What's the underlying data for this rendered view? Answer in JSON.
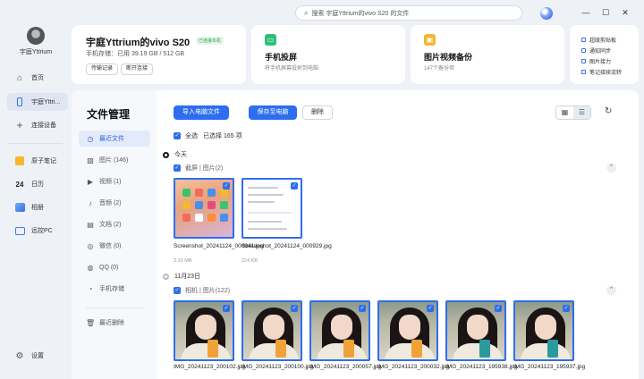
{
  "window": {
    "search_placeholder": "搜索 宇庭Yttrium的vivo S20 的文件",
    "controls": [
      "—",
      "☐",
      "✕"
    ]
  },
  "rail": {
    "device_name": "宇庭Yttrium",
    "items": [
      {
        "label": "首页",
        "icon": "home-icon"
      },
      {
        "label": "宇庭Yttri...",
        "icon": "phone-icon"
      },
      {
        "label": "连接设备",
        "icon": "plus-icon"
      },
      {
        "label": "原子笔记",
        "icon": "notes-icon"
      },
      {
        "label": "日历",
        "icon": "calendar-icon"
      },
      {
        "label": "相册",
        "icon": "album-icon"
      },
      {
        "label": "远控PC",
        "icon": "remote-pc-icon"
      }
    ],
    "settings_label": "设置"
  },
  "device_card": {
    "title": "宇庭Yttrium的vivo S20",
    "badge": "已连接本机",
    "storage": "手机存储：已用 39.19 GB / 512 GB",
    "buttons": [
      "传输记录",
      "断开连接"
    ]
  },
  "feature_cards": [
    {
      "title": "手机投屏",
      "subtitle": "将手机屏幕投射到电脑",
      "icon": "screen-mirror-icon",
      "color": "#2fbf7a"
    },
    {
      "title": "图片视频备份",
      "subtitle": "147个备份项",
      "icon": "gallery-backup-icon",
      "color": "#f2b632"
    }
  ],
  "quick_settings": [
    "超级剪贴板",
    "通知同步",
    "图片接力",
    "笔记接续流转"
  ],
  "files": {
    "title": "文件管理",
    "categories": [
      {
        "label": "最近文件",
        "icon": "recent-icon"
      },
      {
        "label": "图片 (146)",
        "icon": "image-icon"
      },
      {
        "label": "视频 (1)",
        "icon": "video-icon"
      },
      {
        "label": "音频 (2)",
        "icon": "audio-icon"
      },
      {
        "label": "文档 (2)",
        "icon": "document-icon"
      },
      {
        "label": "微信 (0)",
        "icon": "wechat-icon"
      },
      {
        "label": "QQ (0)",
        "icon": "qq-icon"
      },
      {
        "label": "手机存储",
        "icon": "storage-icon"
      }
    ],
    "recycle_label": "最近删除",
    "toolbar": {
      "import": "导入电脑文件",
      "save": "保存至电脑",
      "delete": "删除"
    },
    "select_all": "全选",
    "selected_count": "已选择 165 项",
    "groups": [
      {
        "date": "今天",
        "section": "截屏 | 图片(2)",
        "items": [
          {
            "name": "Screenshot_20241124_000941.jpg",
            "size": "3.33 MB"
          },
          {
            "name": "Screenshot_20241124_000929.jpg",
            "size": "224 KB"
          }
        ]
      },
      {
        "date": "11月23日",
        "section": "相机 | 图片(122)",
        "items": [
          {
            "name": "IMG_20241123_200102.jpg"
          },
          {
            "name": "IMG_20241123_200100.jpg"
          },
          {
            "name": "IMG_20241123_200057.jpg"
          },
          {
            "name": "IMG_20241123_200032.jpg"
          },
          {
            "name": "IMG_20241123_195938.jpg"
          },
          {
            "name": "IMG_20241123_195937.jpg"
          }
        ]
      }
    ]
  },
  "colors": {
    "accent": "#2d6ef0",
    "success": "#2fa44a"
  }
}
